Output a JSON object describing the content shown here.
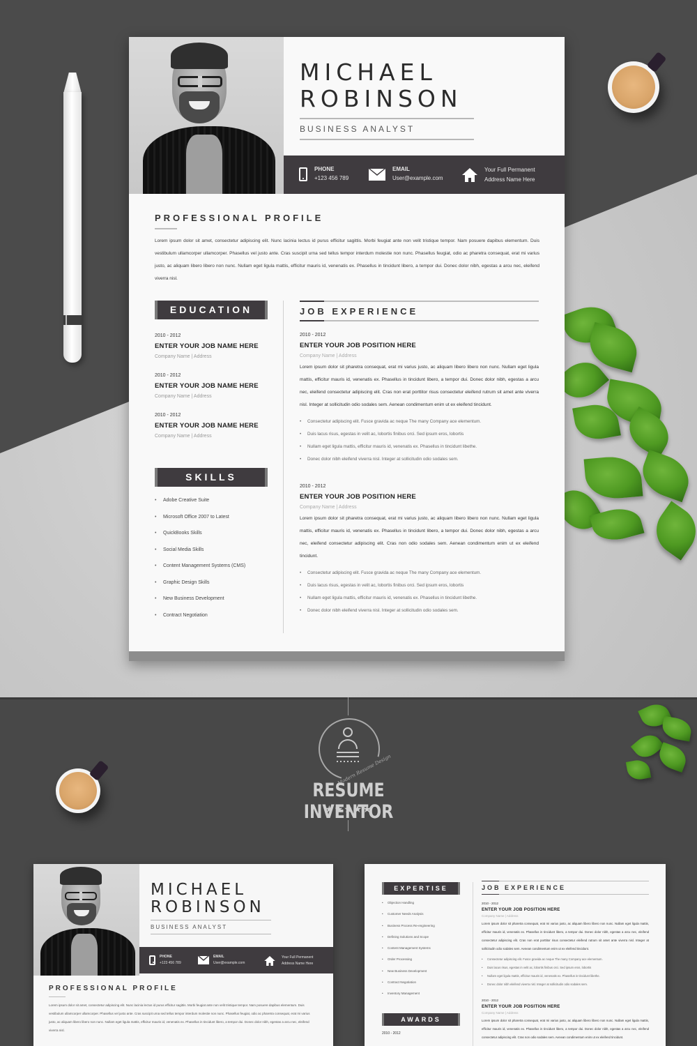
{
  "resume": {
    "first_name": "MICHAEL",
    "last_name": "ROBINSON",
    "title": "BUSINESS ANALYST",
    "contact": {
      "phone_label": "PHONE",
      "phone_value": "+123 456 789",
      "email_label": "EMAIL",
      "email_value": "User@example.com",
      "address_line1": "Your Full Permanent",
      "address_line2": "Address Name Here"
    },
    "profile": {
      "heading": "PROFESSIONAL PROFILE",
      "text": "Lorem ipsum dolor sit amet, consectetur adipiscing elit. Nunc lacinia lectus id purus efficitur sagittis. Morbi feugiat ante non velit tristique tempor. Nam posuere dapibus elementum. Duis vestibulum ullamcorper ullamcorper. Phasellus vel justo ante. Cras suscipit urna sed tellus tempor interdum molestie non nunc. Phasellus feugiat, odio ac pharetra consequat, erat mi varius justo, ac aliquam libero libero non nunc. Nullam eget ligula mattis, efficitur mauris id, venenatis ex. Phasellus in tincidunt libero, a tempor dui. Donec dolor nibh, egestas a arcu nec, eleifend viverra nisl."
    },
    "education": {
      "heading": "EDUCATION",
      "items": [
        {
          "date": "2010 - 2012",
          "name": "ENTER YOUR JOB NAME HERE",
          "company": "Company Name |  Address"
        },
        {
          "date": "2010 - 2012",
          "name": "ENTER YOUR JOB NAME HERE",
          "company": "Company Name |  Address"
        },
        {
          "date": "2010 - 2012",
          "name": "ENTER YOUR JOB NAME HERE",
          "company": "Company Name |  Address"
        }
      ]
    },
    "skills": {
      "heading": "SKILLS",
      "items": [
        "Adobe Creative Suite",
        "Microsoft Office 2007 to Latest",
        "QuickBooks Skills",
        "Social Media Skills",
        "Content Management Systems (CMS)",
        "Graphic Design Skills",
        "New Business Development",
        "Contract Negotiation"
      ]
    },
    "experience": {
      "heading": "JOB EXPERIENCE",
      "jobs": [
        {
          "date": "2010 - 2012",
          "position": "ENTER YOUR JOB POSITION HERE",
          "company": "Company Name |  Address",
          "description": "Lorem ipsum dolor sit pharetra consequat, erat mi varius justo, ac aliquam libero libero non nunc. Nullam eget ligula mattis, efficitur mauris id, venenatis ex. Phasellus in tincidunt libero, a tempor dui. Donec dolor nibh, egestas a arcu nec, eleifend consectetur adipiscing elit. Cras non erat porttitor risus consectetur eleifend rutrum sit amet ante viverra nisl. Integer at sollicitudin odio sodales sem. Aenean condimentum enim ut ex eleifend tincidunt.",
          "bullets": [
            "Consectetur adipiscing elit. Fusce gravida ac neque The many Company ace elementum.",
            "Duis lacus risus, egestas in velit ac, lobortis finibus orci. Sed ipsum eros, lobortis",
            "Nullam eget ligula mattis, efficitur mauris id, venenatis ex. Phasellus in tincidunt libethe.",
            "Donec dolor nibh eleifend viverra nisl. Integer at sollicitudin odio sodales sem."
          ]
        },
        {
          "date": "2010 - 2012",
          "position": "ENTER YOUR JOB POSITION HERE",
          "company": "Company Name |  Address",
          "description": "Lorem ipsum dolor sit pharetra consequat, erat mi varius justo, ac aliquam libero libero non nunc. Nullam eget ligula mattis, efficitur mauris id, venenatis ex. Phasellus in tincidunt libero, a tempor dui. Donec dolor nibh, egestas a arcu nec, eleifend consectetur adipiscing elit. Cras non odio sodales sem. Aenean condimentum enim ut ex eleifend tincidunt.",
          "bullets": [
            "Consectetur adipiscing elit. Fusce gravida ac neque The many Company ace elementum.",
            "Duis lacus risus, egestas in velit ac, lobortis finibus orci. Sed ipsum eros, lobortis",
            "Nullam eget ligula mattis, efficitur mauris id, venenatis ex. Phasellus in tincidunt libethe.",
            "Donec dolor nibh eleifend viverra nisl. Integer at sollicitudin odio sodales sem."
          ]
        }
      ]
    }
  },
  "logo": {
    "brand": "RESUME INVENTOR",
    "tagline": "Modern Resume Design",
    "stars": "★★★★★",
    "rating": 5
  },
  "page2": {
    "expertise_heading": "EXPERTISE",
    "expertise": [
      "Objection Handling",
      "Customer Needs Analysis",
      "Business Process Re-engineering",
      "Defining Solutions and Scope",
      "Content Management Systems",
      "Order Processing",
      "New Business Development",
      "Contract Negotiation",
      "Inventory Management"
    ],
    "awards_heading": "AWARDS",
    "awards_date": "2010 - 2012"
  },
  "colors": {
    "accent_dark": "#3f3b3f",
    "sheet_bg": "#f9f9f9",
    "text": "#2b2b2b"
  }
}
